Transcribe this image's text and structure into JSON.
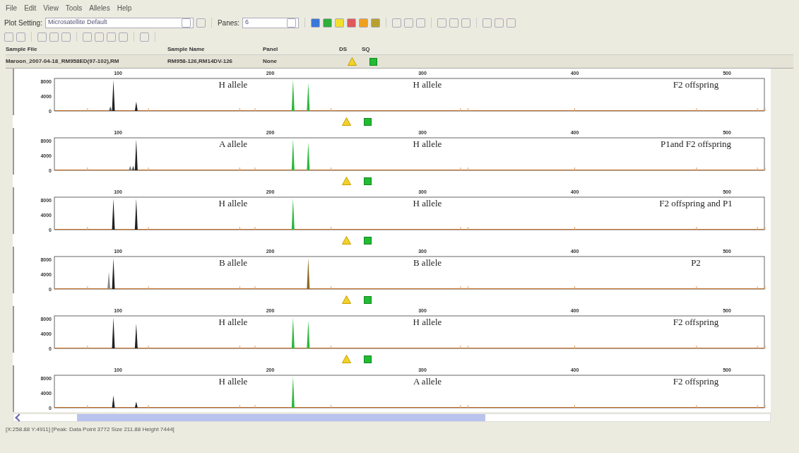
{
  "menu": [
    "File",
    "Edit",
    "View",
    "Tools",
    "Alleles",
    "Help"
  ],
  "toolbar": {
    "plot_setting_label": "Plot Setting:",
    "plot_setting": "Microsatellite Default",
    "panes_label": "Panes:",
    "panes": "6"
  },
  "columns": [
    "Sample File",
    "Sample Name",
    "Panel",
    "DS",
    "SQ"
  ],
  "sample": {
    "file": "Maroon_2007-04-18_RM958ED(97-102),RM",
    "name": "RM958-126,RM14DV-126",
    "panel": "None"
  },
  "panels": [
    {
      "x_ticks": [
        "100",
        "200",
        "300",
        "400",
        "500"
      ],
      "y_ticks": [
        "8000",
        "4000",
        "0"
      ],
      "annotations": [
        "H allele",
        "H allele",
        "F2 offspring"
      ]
    },
    {
      "x_ticks": [
        "100",
        "200",
        "300",
        "400",
        "500"
      ],
      "y_ticks": [
        "8000",
        "4000",
        "0"
      ],
      "annotations": [
        "A allele",
        "H allele",
        "P1and F2 offspring"
      ]
    },
    {
      "x_ticks": [
        "100",
        "200",
        "300",
        "400",
        "500"
      ],
      "y_ticks": [
        "8000",
        "4000",
        "0"
      ],
      "annotations": [
        "H allele",
        "H allele",
        "F2 offspring and P1"
      ]
    },
    {
      "x_ticks": [
        "100",
        "200",
        "300",
        "400",
        "500"
      ],
      "y_ticks": [
        "8000",
        "4000",
        "0"
      ],
      "annotations": [
        "B allele",
        "B allele",
        "P2"
      ]
    },
    {
      "x_ticks": [
        "100",
        "200",
        "300",
        "400",
        "500"
      ],
      "y_ticks": [
        "8000",
        "4000",
        "0"
      ],
      "annotations": [
        "H allele",
        "H allele",
        "F2 offspring"
      ]
    },
    {
      "x_ticks": [
        "100",
        "200",
        "300",
        "400",
        "500"
      ],
      "y_ticks": [
        "8000",
        "4000",
        "0"
      ],
      "annotations": [
        "H allele",
        "A allele",
        "F2 offspring"
      ]
    }
  ],
  "status": "[X:258.88 Y:4911] [Peak: Data Point 3772 Size 211.88 Height 7444]"
}
